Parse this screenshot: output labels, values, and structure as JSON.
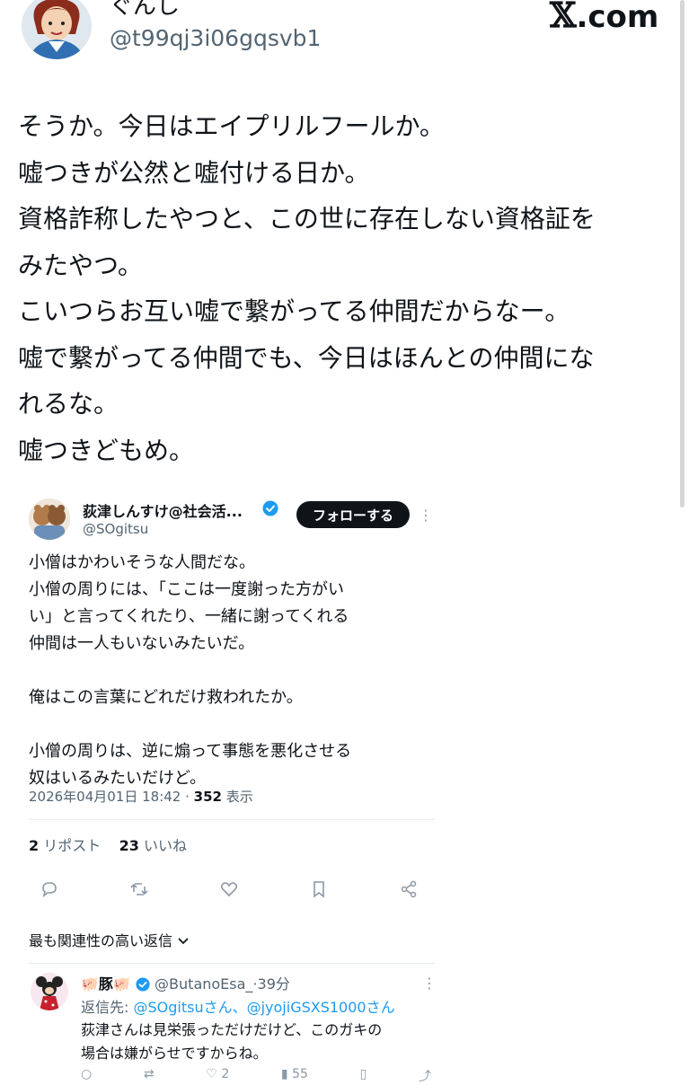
{
  "header": {
    "display_name": "ぐんし",
    "handle": "@t99qj3i06gqsvb1",
    "site_logo": ".com",
    "logo_icon": "x-logo-icon"
  },
  "tweet": {
    "lines": [
      "そうか。今日はエイプリルフールか。",
      "嘘つきが公然と嘘付ける日か。",
      "資格詐称したやつと、この世に存在しない資格証を",
      "みたやつ。",
      "こいつらお互い嘘で繋がってる仲間だからなー。",
      "嘘で繋がってる仲間でも、今日はほんとの仲間にな",
      "れるな。",
      "嘘つきどもめ。"
    ]
  },
  "embedded": {
    "name": "荻津しんすけ@社会活...",
    "handle": "@SOgitsu",
    "follow_label": "フォローする",
    "text_lines": [
      "小僧はかわいそうな人間だな。",
      "小僧の周りには、「ここは一度謝った方がい",
      "い」と言ってくれたり、一緒に謝ってくれる",
      "仲間は一人もいないみたいだ。",
      "",
      "俺はこの言葉にどれだけ救われたか。",
      "",
      "小僧の周りは、逆に煽って事態を悪化させる",
      "奴はいるみたいだけど。"
    ],
    "timestamp": "2026年04月01日 18:42",
    "views_count": "352",
    "views_label": "表示",
    "reposts_count": "2",
    "reposts_label": "リポスト",
    "likes_count": "23",
    "likes_label": "いいね",
    "reply_sort_label": "最も関連性の高い返信"
  },
  "reply": {
    "name": "🐖豚🐖",
    "handle": "@ButanoEsa_",
    "time": "39分",
    "reply_to_prefix": "返信先:",
    "reply_to_users": "@SOgitsuさん、@jyojiGSXS1000さん",
    "text_lines": [
      "荻津さんは見栄張っただけだけど、このガキの",
      "場合は嫌がらせですからね。"
    ],
    "reply_count": "",
    "like_count": "2",
    "view_count": "55"
  },
  "colors": {
    "text": "#0f1419",
    "muted": "#536471",
    "link": "#1d9bf0",
    "verified": "#1d9bf0",
    "button_bg": "#0f1419"
  }
}
